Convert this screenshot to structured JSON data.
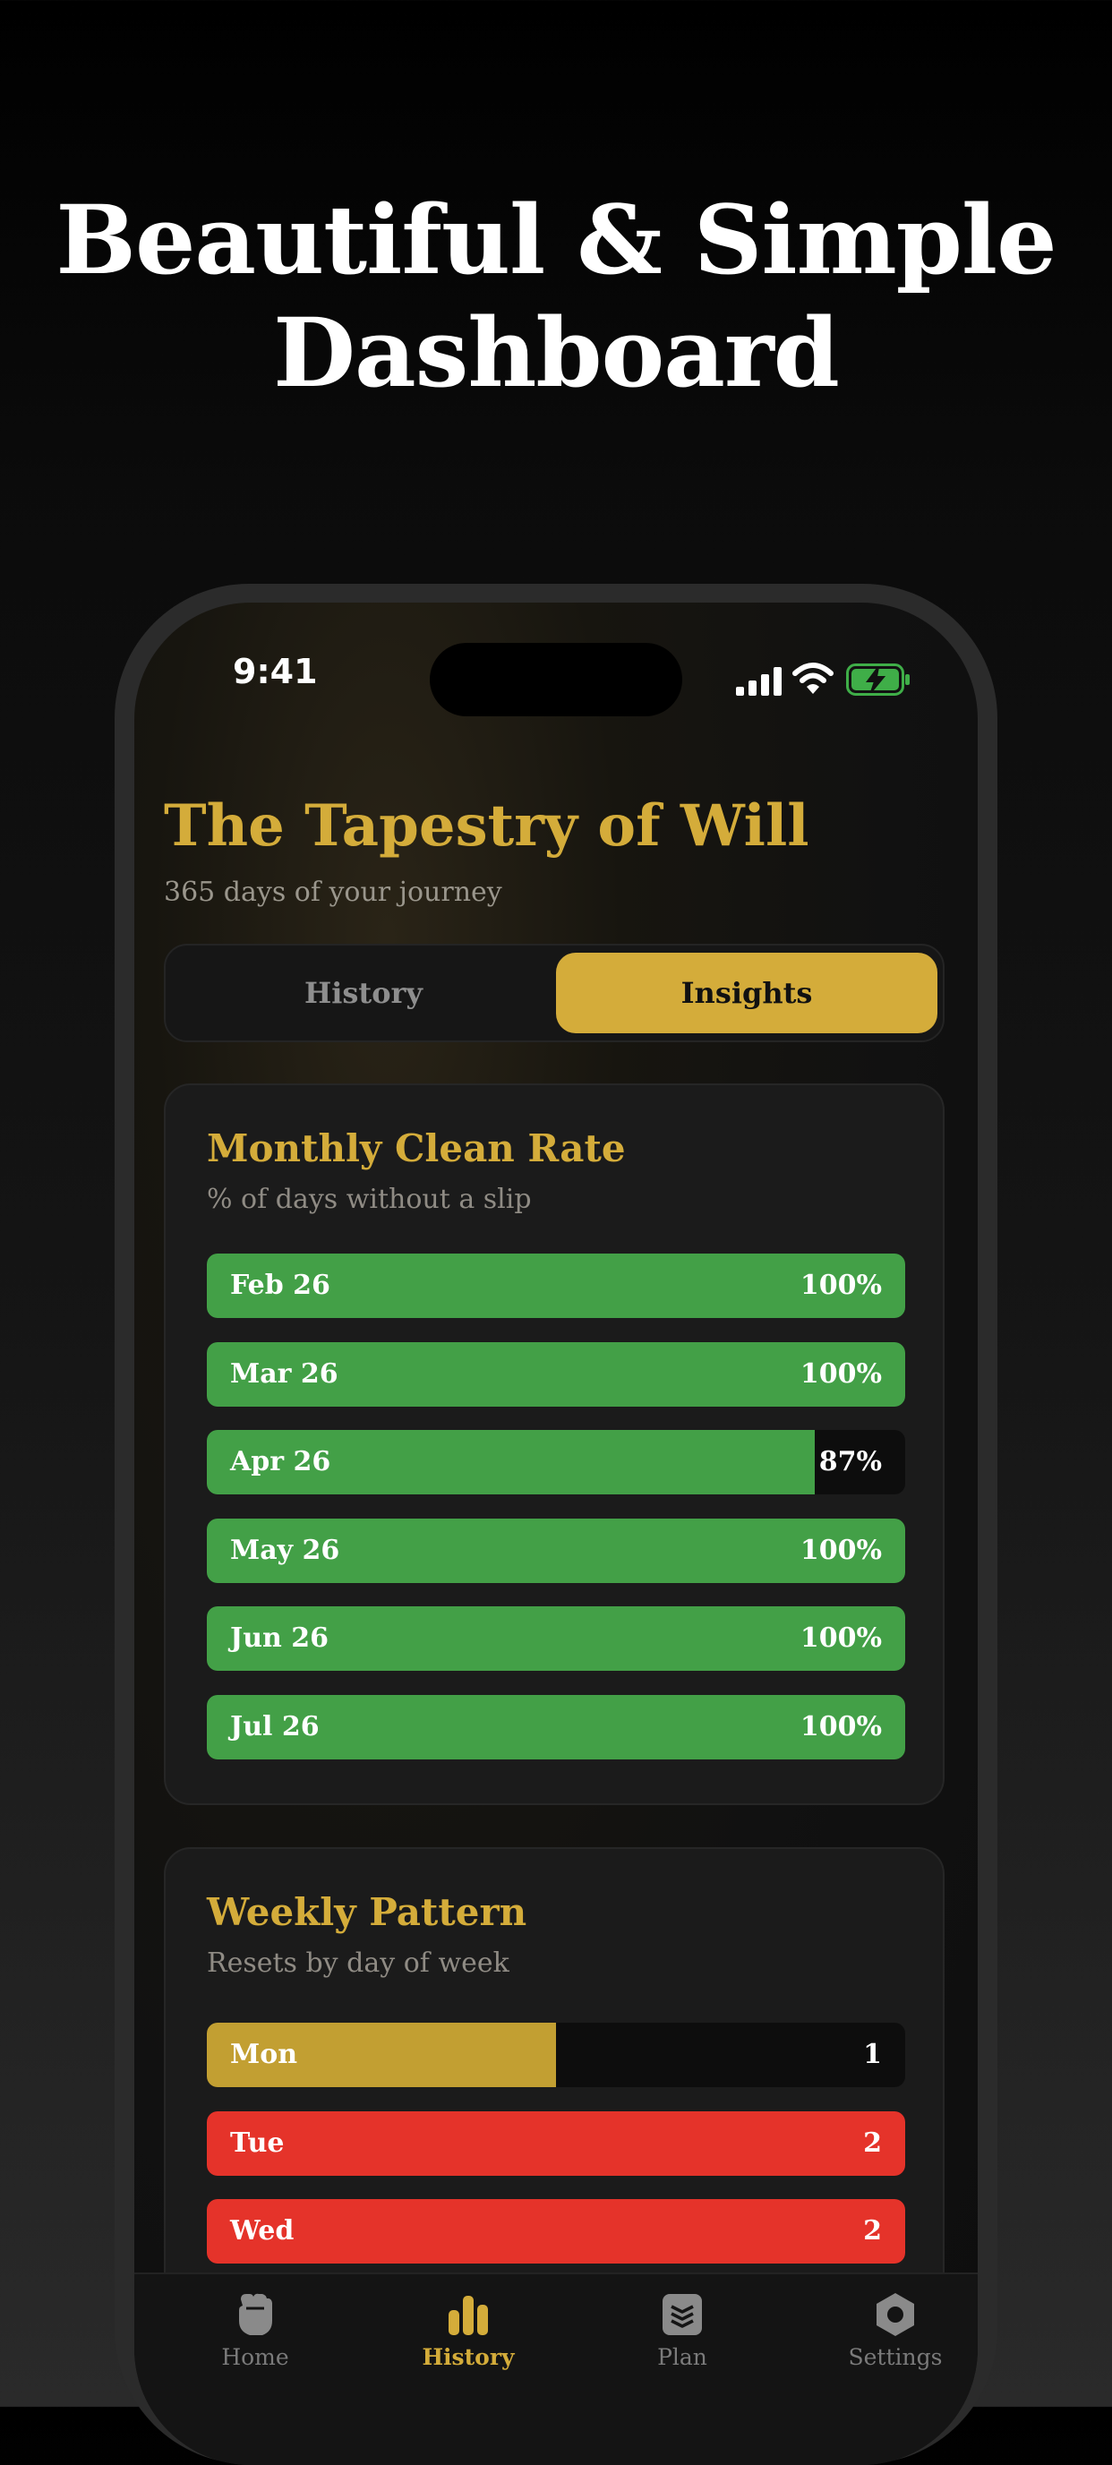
{
  "marketing": {
    "headline_line1": "Beautiful & Simple",
    "headline_line2": "Dashboard"
  },
  "status_bar": {
    "time": "9:41"
  },
  "header": {
    "title": "The Tapestry of Will",
    "subtitle": "365 days of your journey"
  },
  "segmented_control": {
    "history_label": "History",
    "insights_label": "Insights",
    "selected": "Insights"
  },
  "monthly_clean_rate": {
    "title": "Monthly Clean Rate",
    "subtitle": "% of days without a slip",
    "rows": [
      {
        "label": "Feb 26",
        "value_text": "100%",
        "fraction": 1.0
      },
      {
        "label": "Mar 26",
        "value_text": "100%",
        "fraction": 1.0
      },
      {
        "label": "Apr 26",
        "value_text": "87%",
        "fraction": 0.87
      },
      {
        "label": "May 26",
        "value_text": "100%",
        "fraction": 1.0
      },
      {
        "label": "Jun 26",
        "value_text": "100%",
        "fraction": 1.0
      },
      {
        "label": "Jul 26",
        "value_text": "100%",
        "fraction": 1.0
      }
    ]
  },
  "weekly_pattern": {
    "title": "Weekly Pattern",
    "subtitle": "Resets by day of week",
    "rows": [
      {
        "label": "Mon",
        "value_text": "1",
        "fraction": 0.5
      },
      {
        "label": "Tue",
        "value_text": "2",
        "fraction": 1.0
      },
      {
        "label": "Wed",
        "value_text": "2",
        "fraction": 1.0
      }
    ]
  },
  "tab_bar": {
    "items": [
      {
        "label": "Home",
        "icon": "fist-icon"
      },
      {
        "label": "History",
        "icon": "bar-chart-icon"
      },
      {
        "label": "Plan",
        "icon": "stack-icon"
      },
      {
        "label": "Settings",
        "icon": "gear-icon"
      }
    ],
    "active": "History"
  },
  "colors": {
    "accent_gold": "#d4ac3a",
    "clean_green": "#43a047",
    "reset_red": "#e5332a",
    "reset_gold": "#c29f32",
    "background": "#111111"
  }
}
